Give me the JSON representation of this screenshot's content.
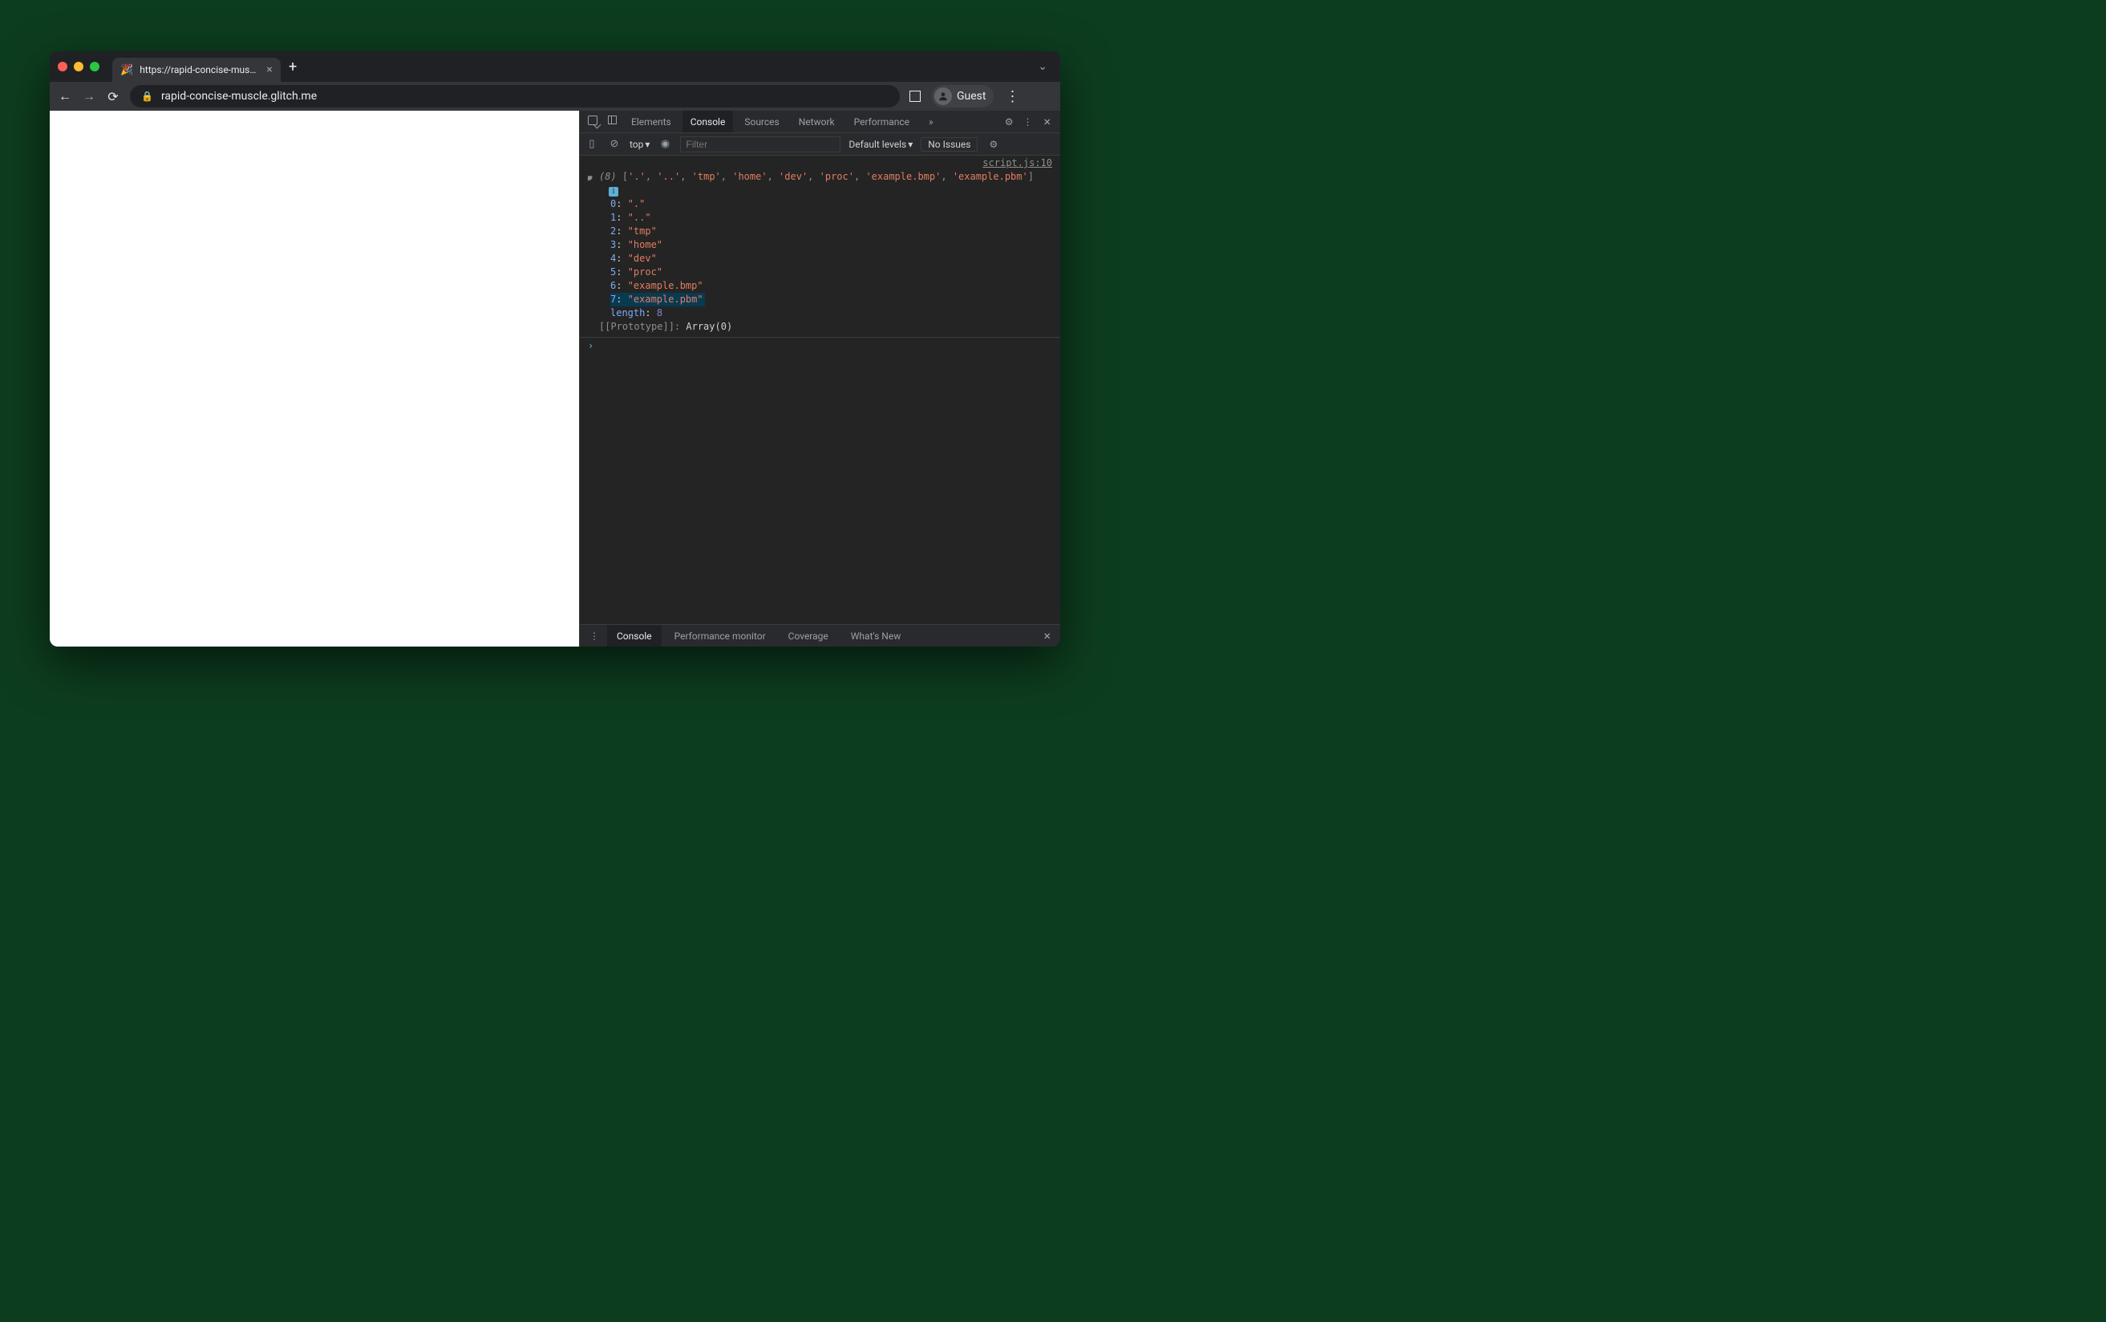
{
  "tab": {
    "favicon": "🎉",
    "title": "https://rapid-concise-muscle.g"
  },
  "address": {
    "url": "rapid-concise-muscle.glitch.me"
  },
  "profile": {
    "label": "Guest"
  },
  "devtools": {
    "tabs": {
      "elements": "Elements",
      "console": "Console",
      "sources": "Sources",
      "network": "Network",
      "performance": "Performance",
      "more": "»"
    },
    "console_toolbar": {
      "context": "top",
      "filter_placeholder": "Filter",
      "default_levels": "Default levels",
      "no_issues": "No Issues"
    },
    "console": {
      "source_link": "script.js:10",
      "array_count_label": "(8)",
      "array_preview_items": [
        ".",
        "..",
        "tmp",
        "home",
        "dev",
        "proc",
        "example.bmp",
        "example.pbm"
      ],
      "entries": [
        {
          "index": "0",
          "value": "."
        },
        {
          "index": "1",
          "value": ".."
        },
        {
          "index": "2",
          "value": "tmp"
        },
        {
          "index": "3",
          "value": "home"
        },
        {
          "index": "4",
          "value": "dev"
        },
        {
          "index": "5",
          "value": "proc"
        },
        {
          "index": "6",
          "value": "example.bmp"
        },
        {
          "index": "7",
          "value": "example.pbm"
        }
      ],
      "selected_index": 7,
      "length_key": "length",
      "length_value": "8",
      "prototype_label": "[[Prototype]]",
      "prototype_value": "Array(0)"
    },
    "drawer": {
      "console": "Console",
      "perf_monitor": "Performance monitor",
      "coverage": "Coverage",
      "whats_new": "What's New"
    }
  }
}
